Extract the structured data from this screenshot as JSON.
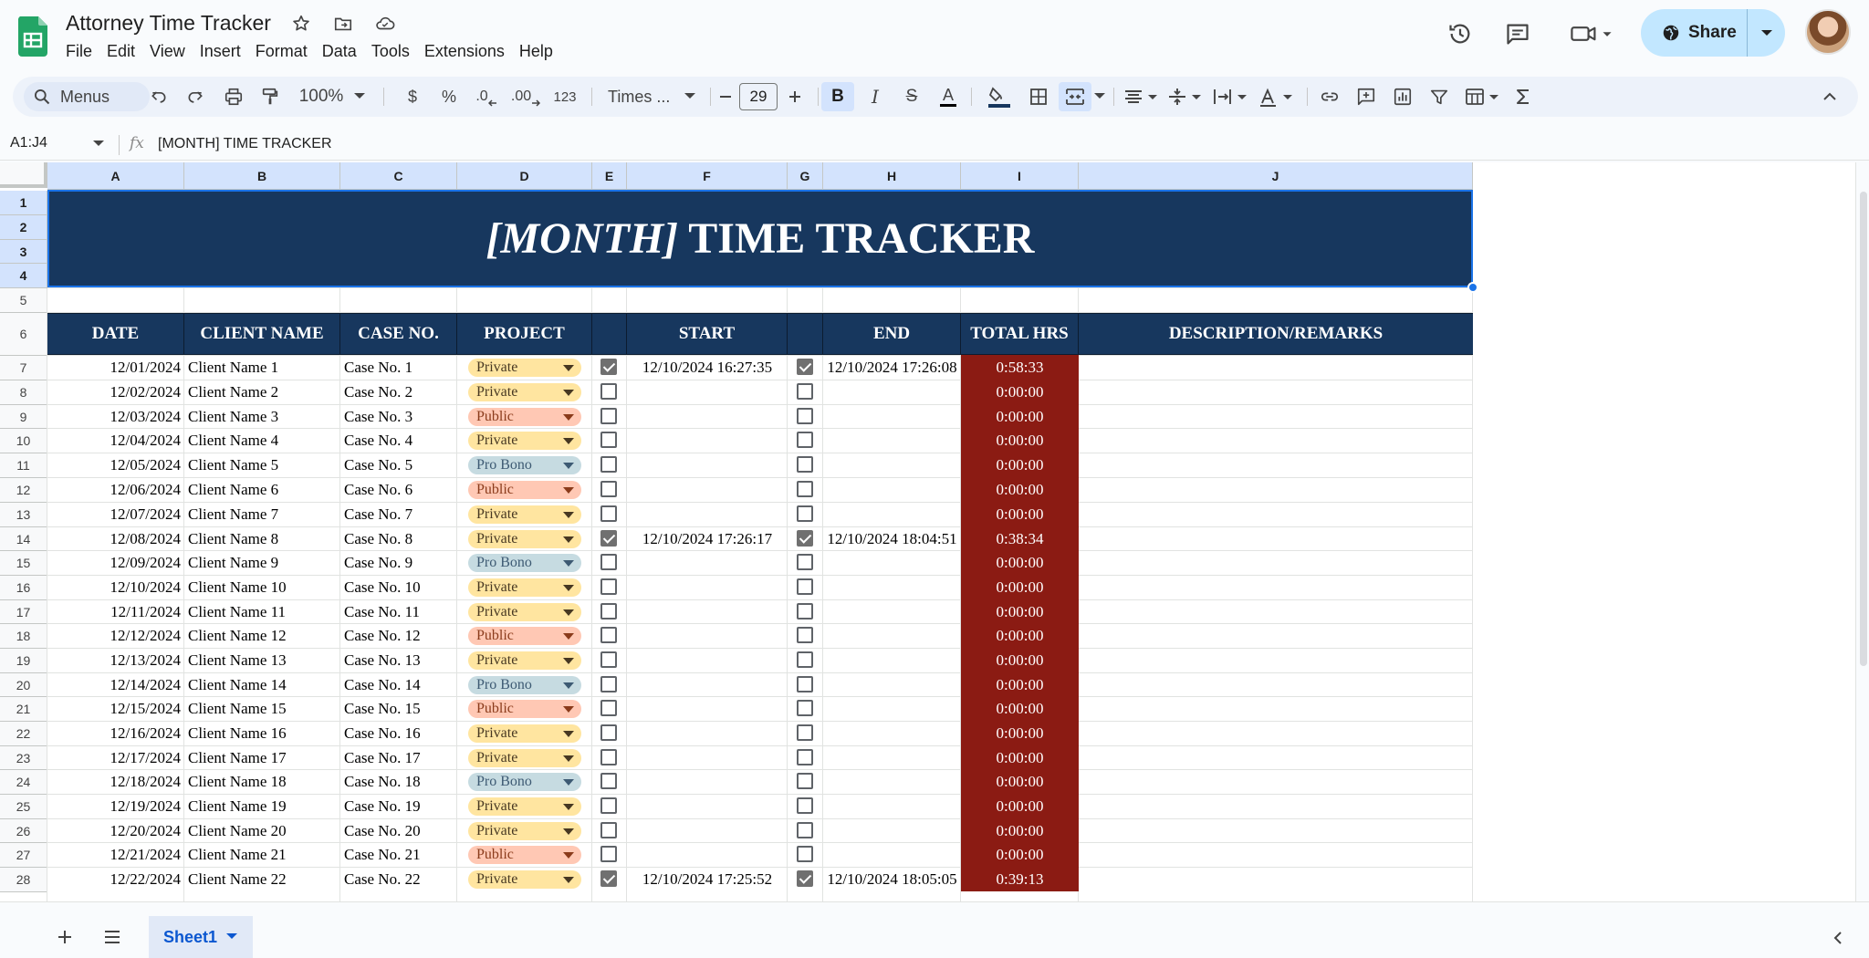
{
  "app": {
    "title": "Attorney Time Tracker",
    "menu": [
      "File",
      "Edit",
      "View",
      "Insert",
      "Format",
      "Data",
      "Tools",
      "Extensions",
      "Help"
    ],
    "share_label": "Share"
  },
  "toolbar": {
    "search_label": "Menus",
    "zoom": "100%",
    "currency": "$",
    "percent": "%",
    "dec_decrease": ".0",
    "dec_increase": ".00",
    "number_format": "123",
    "font": "Times ...",
    "font_size": "29",
    "bold": "B",
    "italic": "I",
    "strike": "S",
    "text_color": "A"
  },
  "formula_bar": {
    "name_box": "A1:J4",
    "fx": "fx",
    "formula": "[MONTH] TIME TRACKER"
  },
  "columns": [
    "A",
    "B",
    "C",
    "D",
    "E",
    "F",
    "G",
    "H",
    "I",
    "J"
  ],
  "row_numbers": [
    "1",
    "2",
    "3",
    "4",
    "5",
    "6",
    "7",
    "8",
    "9",
    "10",
    "11",
    "12",
    "13",
    "14",
    "15",
    "16",
    "17",
    "18",
    "19",
    "20",
    "21",
    "22",
    "23",
    "24",
    "25",
    "26",
    "27",
    "28"
  ],
  "sheet_title": {
    "italic_part": "[MONTH]",
    "rest": " TIME TRACKER"
  },
  "headers": {
    "date": "DATE",
    "client": "CLIENT NAME",
    "case": "CASE NO.",
    "project": "PROJECT",
    "start": "START",
    "end": "END",
    "total": "TOTAL HRS",
    "desc": "DESCRIPTION/REMARKS"
  },
  "rows": [
    {
      "date": "12/01/2024",
      "client": "Client Name 1",
      "case": "Case No. 1",
      "project": "Private",
      "start_checked": true,
      "start": "12/10/2024 16:27:35",
      "end_checked": true,
      "end": "12/10/2024 17:26:08",
      "total": "0:58:33"
    },
    {
      "date": "12/02/2024",
      "client": "Client Name 2",
      "case": "Case No. 2",
      "project": "Private",
      "start_checked": false,
      "start": "",
      "end_checked": false,
      "end": "",
      "total": "0:00:00"
    },
    {
      "date": "12/03/2024",
      "client": "Client Name 3",
      "case": "Case No. 3",
      "project": "Public",
      "start_checked": false,
      "start": "",
      "end_checked": false,
      "end": "",
      "total": "0:00:00"
    },
    {
      "date": "12/04/2024",
      "client": "Client Name 4",
      "case": "Case No. 4",
      "project": "Private",
      "start_checked": false,
      "start": "",
      "end_checked": false,
      "end": "",
      "total": "0:00:00"
    },
    {
      "date": "12/05/2024",
      "client": "Client Name 5",
      "case": "Case No. 5",
      "project": "Pro Bono",
      "start_checked": false,
      "start": "",
      "end_checked": false,
      "end": "",
      "total": "0:00:00"
    },
    {
      "date": "12/06/2024",
      "client": "Client Name 6",
      "case": "Case No. 6",
      "project": "Public",
      "start_checked": false,
      "start": "",
      "end_checked": false,
      "end": "",
      "total": "0:00:00"
    },
    {
      "date": "12/07/2024",
      "client": "Client Name 7",
      "case": "Case No. 7",
      "project": "Private",
      "start_checked": false,
      "start": "",
      "end_checked": false,
      "end": "",
      "total": "0:00:00"
    },
    {
      "date": "12/08/2024",
      "client": "Client Name 8",
      "case": "Case No. 8",
      "project": "Private",
      "start_checked": true,
      "start": "12/10/2024 17:26:17",
      "end_checked": true,
      "end": "12/10/2024 18:04:51",
      "total": "0:38:34"
    },
    {
      "date": "12/09/2024",
      "client": "Client Name 9",
      "case": "Case No. 9",
      "project": "Pro Bono",
      "start_checked": false,
      "start": "",
      "end_checked": false,
      "end": "",
      "total": "0:00:00"
    },
    {
      "date": "12/10/2024",
      "client": "Client Name 10",
      "case": "Case No. 10",
      "project": "Private",
      "start_checked": false,
      "start": "",
      "end_checked": false,
      "end": "",
      "total": "0:00:00"
    },
    {
      "date": "12/11/2024",
      "client": "Client Name 11",
      "case": "Case No. 11",
      "project": "Private",
      "start_checked": false,
      "start": "",
      "end_checked": false,
      "end": "",
      "total": "0:00:00"
    },
    {
      "date": "12/12/2024",
      "client": "Client Name 12",
      "case": "Case No. 12",
      "project": "Public",
      "start_checked": false,
      "start": "",
      "end_checked": false,
      "end": "",
      "total": "0:00:00"
    },
    {
      "date": "12/13/2024",
      "client": "Client Name 13",
      "case": "Case No. 13",
      "project": "Private",
      "start_checked": false,
      "start": "",
      "end_checked": false,
      "end": "",
      "total": "0:00:00"
    },
    {
      "date": "12/14/2024",
      "client": "Client Name 14",
      "case": "Case No. 14",
      "project": "Pro Bono",
      "start_checked": false,
      "start": "",
      "end_checked": false,
      "end": "",
      "total": "0:00:00"
    },
    {
      "date": "12/15/2024",
      "client": "Client Name 15",
      "case": "Case No. 15",
      "project": "Public",
      "start_checked": false,
      "start": "",
      "end_checked": false,
      "end": "",
      "total": "0:00:00"
    },
    {
      "date": "12/16/2024",
      "client": "Client Name 16",
      "case": "Case No. 16",
      "project": "Private",
      "start_checked": false,
      "start": "",
      "end_checked": false,
      "end": "",
      "total": "0:00:00"
    },
    {
      "date": "12/17/2024",
      "client": "Client Name 17",
      "case": "Case No. 17",
      "project": "Private",
      "start_checked": false,
      "start": "",
      "end_checked": false,
      "end": "",
      "total": "0:00:00"
    },
    {
      "date": "12/18/2024",
      "client": "Client Name 18",
      "case": "Case No. 18",
      "project": "Pro Bono",
      "start_checked": false,
      "start": "",
      "end_checked": false,
      "end": "",
      "total": "0:00:00"
    },
    {
      "date": "12/19/2024",
      "client": "Client Name 19",
      "case": "Case No. 19",
      "project": "Private",
      "start_checked": false,
      "start": "",
      "end_checked": false,
      "end": "",
      "total": "0:00:00"
    },
    {
      "date": "12/20/2024",
      "client": "Client Name 20",
      "case": "Case No. 20",
      "project": "Private",
      "start_checked": false,
      "start": "",
      "end_checked": false,
      "end": "",
      "total": "0:00:00"
    },
    {
      "date": "12/21/2024",
      "client": "Client Name 21",
      "case": "Case No. 21",
      "project": "Public",
      "start_checked": false,
      "start": "",
      "end_checked": false,
      "end": "",
      "total": "0:00:00"
    },
    {
      "date": "12/22/2024",
      "client": "Client Name 22",
      "case": "Case No. 22",
      "project": "Private",
      "start_checked": true,
      "start": "12/10/2024 17:25:52",
      "end_checked": true,
      "end": "12/10/2024 18:05:05",
      "total": "0:39:13"
    }
  ],
  "sheet_tabs": [
    "Sheet1"
  ],
  "colors": {
    "title_band": "#17375e",
    "total_col": "#8b1b13",
    "private_chip": "#ffe5a0",
    "public_chip": "#ffc8b4",
    "probono_chip": "#c6dbe1",
    "selection": "#1a73e8",
    "share_button": "#c2e7ff"
  }
}
